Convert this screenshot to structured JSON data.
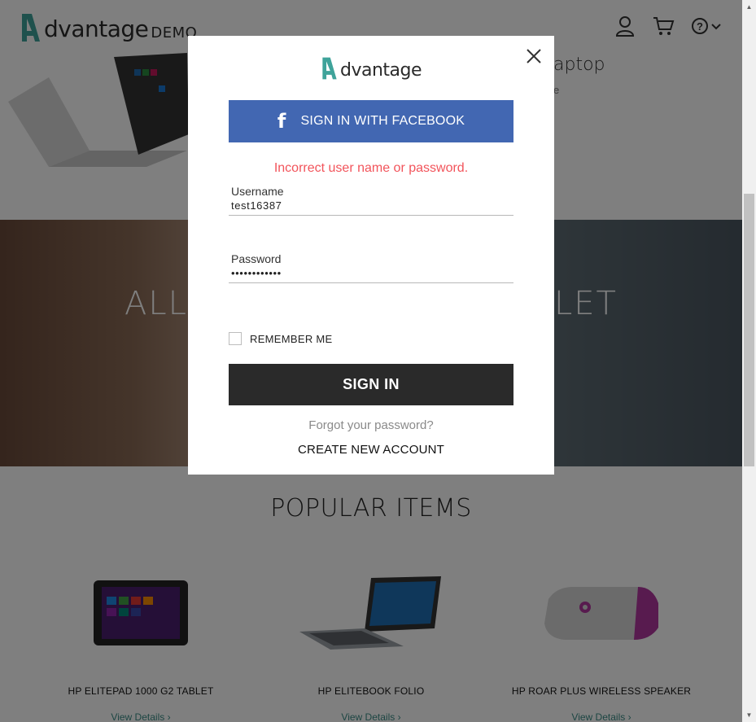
{
  "header": {
    "logo_word": "dvantage",
    "logo_demo": "DEMO",
    "icons": [
      "user-icon",
      "cart-icon",
      "help-icon",
      "chevron-down-icon"
    ]
  },
  "hero": {
    "title_fragment": "aptop",
    "subtitle_fragment": "e",
    "band_text_left": "ALL",
    "band_text_right": "LET"
  },
  "popular": {
    "title": "POPULAR ITEMS",
    "items": [
      {
        "name": "HP ELITEPAD 1000 G2 TABLET",
        "link": "View Details"
      },
      {
        "name": "HP ELITEBOOK FOLIO",
        "link": "View Details"
      },
      {
        "name": "HP ROAR PLUS WIRELESS SPEAKER",
        "link": "View Details"
      }
    ]
  },
  "modal": {
    "logo_word": "dvantage",
    "facebook_label": "SIGN IN WITH FACEBOOK",
    "error": "Incorrect user name or password.",
    "username": {
      "label": "Username",
      "value": "test16387"
    },
    "password": {
      "label": "Password",
      "value": "••••••••••••"
    },
    "remember_label": "REMEMBER ME",
    "signin_label": "SIGN IN",
    "forgot_label": "Forgot your password?",
    "create_label": "CREATE NEW ACCOUNT"
  },
  "colors": {
    "brand_teal": "#3fa39a",
    "facebook_blue": "#4267b2",
    "error_red": "#f2545b",
    "signin_dark": "#2a2a2a"
  }
}
